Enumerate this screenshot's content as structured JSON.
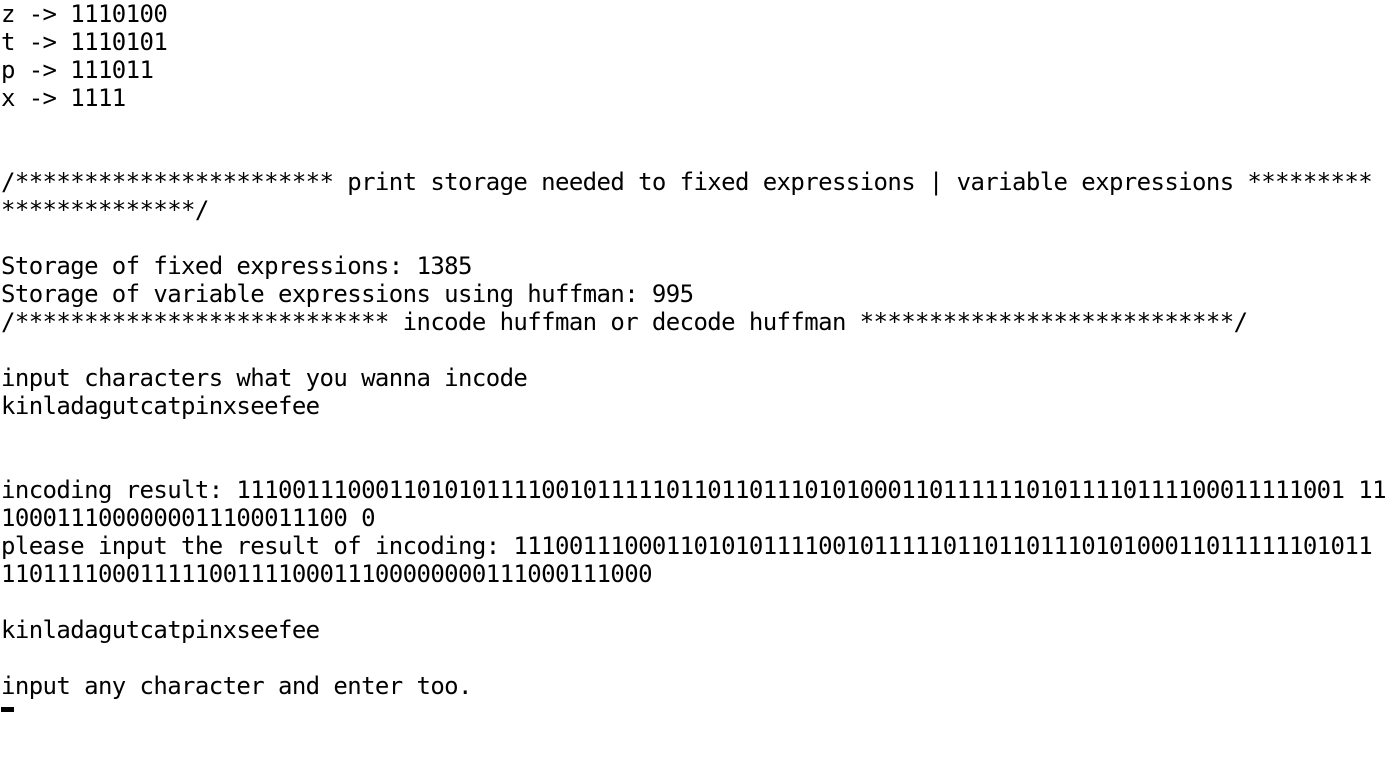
{
  "console": {
    "lines": [
      "z -> 1110100",
      "t -> 1110101",
      "p -> 111011",
      "x -> 1111",
      "",
      "",
      "/*********************** print storage needed to fixed expressions | variable expressions *********",
      "**************/",
      "",
      "Storage of fixed expressions: 1385",
      "Storage of variable expressions using huffman: 995",
      "/*************************** incode huffman or decode huffman ***************************/",
      "",
      "input characters what you wanna incode",
      "kinladagutcatpinxseefee",
      "",
      "",
      "incoding result: 11100111000110101011110010111110110110111010100011011111101011110111100011111001 11",
      "1000111000000011100011100 0",
      "please input the result of incoding: 11100111000110101011110010111110110110111010100011011111101011",
      "11011110001111100111100011100000000111000111000",
      "",
      "kinladagutcatpinxseefee",
      "",
      "input any character and enter too."
    ]
  }
}
